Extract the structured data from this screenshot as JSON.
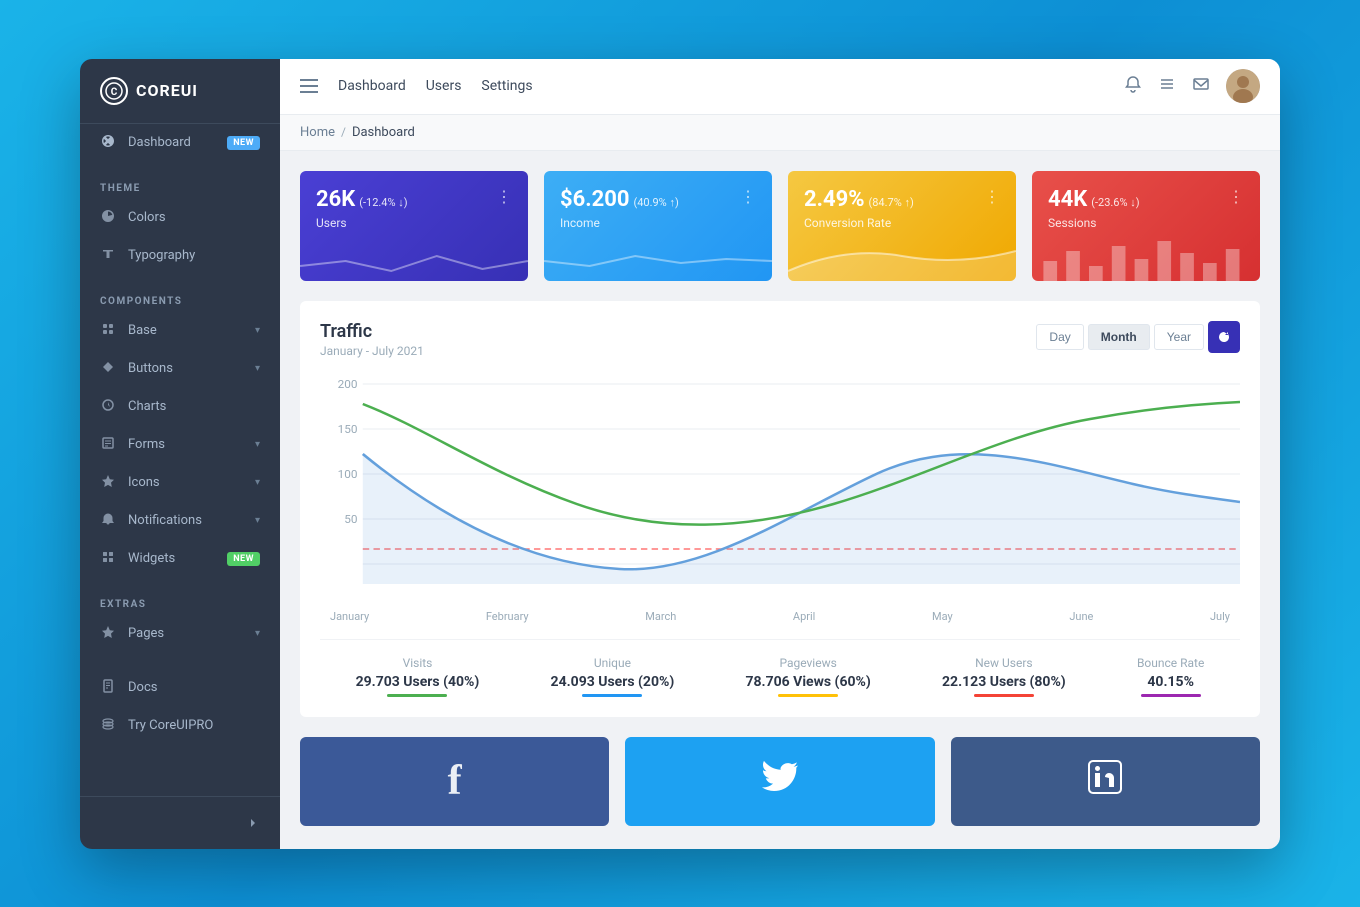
{
  "app": {
    "name": "COREUI",
    "logo_char": "C"
  },
  "topnav": {
    "links": [
      "Dashboard",
      "Users",
      "Settings"
    ],
    "icons": [
      "bell",
      "list",
      "envelope"
    ]
  },
  "breadcrumb": {
    "items": [
      "Home",
      "Dashboard"
    ]
  },
  "sidebar": {
    "dashboard_label": "Dashboard",
    "dashboard_badge": "NEW",
    "theme_section": "THEME",
    "colors_label": "Colors",
    "typography_label": "Typography",
    "components_section": "COMPONENTS",
    "base_label": "Base",
    "buttons_label": "Buttons",
    "charts_label": "Charts",
    "forms_label": "Forms",
    "icons_label": "Icons",
    "notifications_label": "Notifications",
    "widgets_label": "Widgets",
    "widgets_badge": "NEW",
    "extras_section": "EXTRAS",
    "pages_label": "Pages",
    "docs_label": "Docs",
    "try_label": "Try CoreUIPRO"
  },
  "stat_cards": [
    {
      "value": "26K",
      "change": "(-12.4% ↓)",
      "label": "Users",
      "color": "purple"
    },
    {
      "value": "$6.200",
      "change": "(40.9% ↑)",
      "label": "Income",
      "color": "blue"
    },
    {
      "value": "2.49%",
      "change": "(84.7% ↑)",
      "label": "Conversion Rate",
      "color": "yellow"
    },
    {
      "value": "44K",
      "change": "(-23.6% ↓)",
      "label": "Sessions",
      "color": "red"
    }
  ],
  "traffic": {
    "title": "Traffic",
    "subtitle": "January - July 2021",
    "time_buttons": [
      "Day",
      "Month",
      "Year"
    ],
    "active_time": "Month",
    "y_labels": [
      "200",
      "150",
      "100",
      "50"
    ],
    "x_labels": [
      "January",
      "February",
      "March",
      "April",
      "May",
      "June",
      "July"
    ],
    "stats": [
      {
        "label": "Visits",
        "value": "29.703 Users (40%)",
        "color": "#4CAF50"
      },
      {
        "label": "Unique",
        "value": "24.093 Users (20%)",
        "color": "#2196F3"
      },
      {
        "label": "Pageviews",
        "value": "78.706 Views (60%)",
        "color": "#FFC107"
      },
      {
        "label": "New Users",
        "value": "22.123 Users (80%)",
        "color": "#f44336"
      },
      {
        "label": "Bounce Rate",
        "value": "40.15%",
        "color": "#9C27B0"
      }
    ]
  },
  "social": {
    "cards": [
      {
        "platform": "Facebook",
        "icon": "f",
        "color_class": "social-card-fb"
      },
      {
        "platform": "Twitter",
        "icon": "🐦",
        "color_class": "social-card-tw"
      },
      {
        "platform": "LinkedIn",
        "icon": "in",
        "color_class": "social-card-li"
      }
    ]
  }
}
